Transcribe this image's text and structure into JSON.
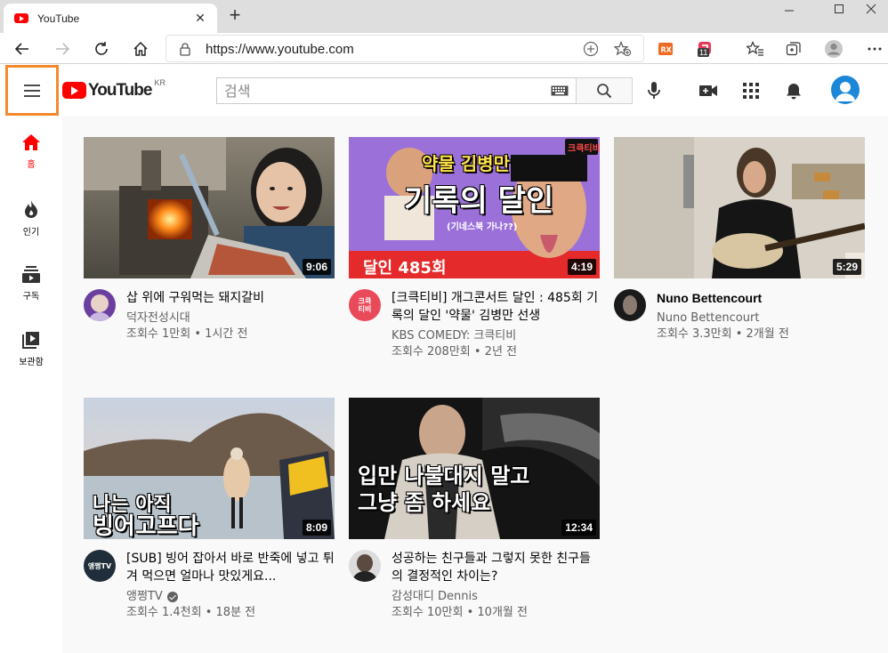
{
  "browser": {
    "tab_title": "YouTube",
    "url": "https://www.youtube.com",
    "extension_badge": "11"
  },
  "masthead": {
    "logo_text": "YouTube",
    "region": "KR",
    "search_placeholder": "검색"
  },
  "guide": [
    {
      "label": "홈",
      "icon": "home-icon",
      "active": true
    },
    {
      "label": "인기",
      "icon": "fire-icon",
      "active": false
    },
    {
      "label": "구독",
      "icon": "subscriptions-icon",
      "active": false
    },
    {
      "label": "보관함",
      "icon": "library-icon",
      "active": false
    }
  ],
  "videos": [
    {
      "title": "삽 위에 구워먹는 돼지갈비",
      "channel": "덕자전성시대",
      "stats": "조회수 1만회 • 1시간 전",
      "duration": "9:06",
      "verified": false
    },
    {
      "title": "[크큭티비] 개그콘서트 달인 : 485회 기록의 달인 '약물' 김병만 선생",
      "channel": "KBS COMEDY: 크큭티비",
      "stats": "조회수 208만회 • 2년 전",
      "duration": "4:19",
      "verified": false,
      "thumb_text": {
        "top": "약물 김병만",
        "main": "기록의 달인",
        "bottom": "달인 485회",
        "brand": "크큭티비",
        "small": "(기네스북 가나??)"
      }
    },
    {
      "title": "Nuno Bettencourt",
      "channel": "Nuno Bettencourt",
      "stats": "조회수 3.3만회 • 2개월 전",
      "duration": "5:29",
      "verified": false
    },
    {
      "title": "[SUB] 빙어 잡아서 바로 반죽에 넣고 튀겨 먹으면 얼마나 맛있게요...",
      "channel": "앵쩡TV",
      "stats": "조회수 1.4천회 • 18분 전",
      "duration": "8:09",
      "verified": true,
      "thumb_text": {
        "line1": "나는 아직",
        "line2": "빙어고프다"
      },
      "avatar_text": "앵쩡TV"
    },
    {
      "title": "성공하는 친구들과 그렇지 못한 친구들의 결정적인 차이는?",
      "channel": "감성대디 Dennis",
      "stats": "조회수 10만회 • 10개월 전",
      "duration": "12:34",
      "verified": false,
      "thumb_text": {
        "line1": "입만 나불대지 말고",
        "line2": "그냥 좀 하세요"
      }
    }
  ],
  "channel_avatar_texts": {
    "kbs": "크큭티비"
  },
  "colors": {
    "youtube_red": "#ff0000",
    "highlight_border": "#f4892f",
    "avatar_blue": "#1c87d8"
  }
}
